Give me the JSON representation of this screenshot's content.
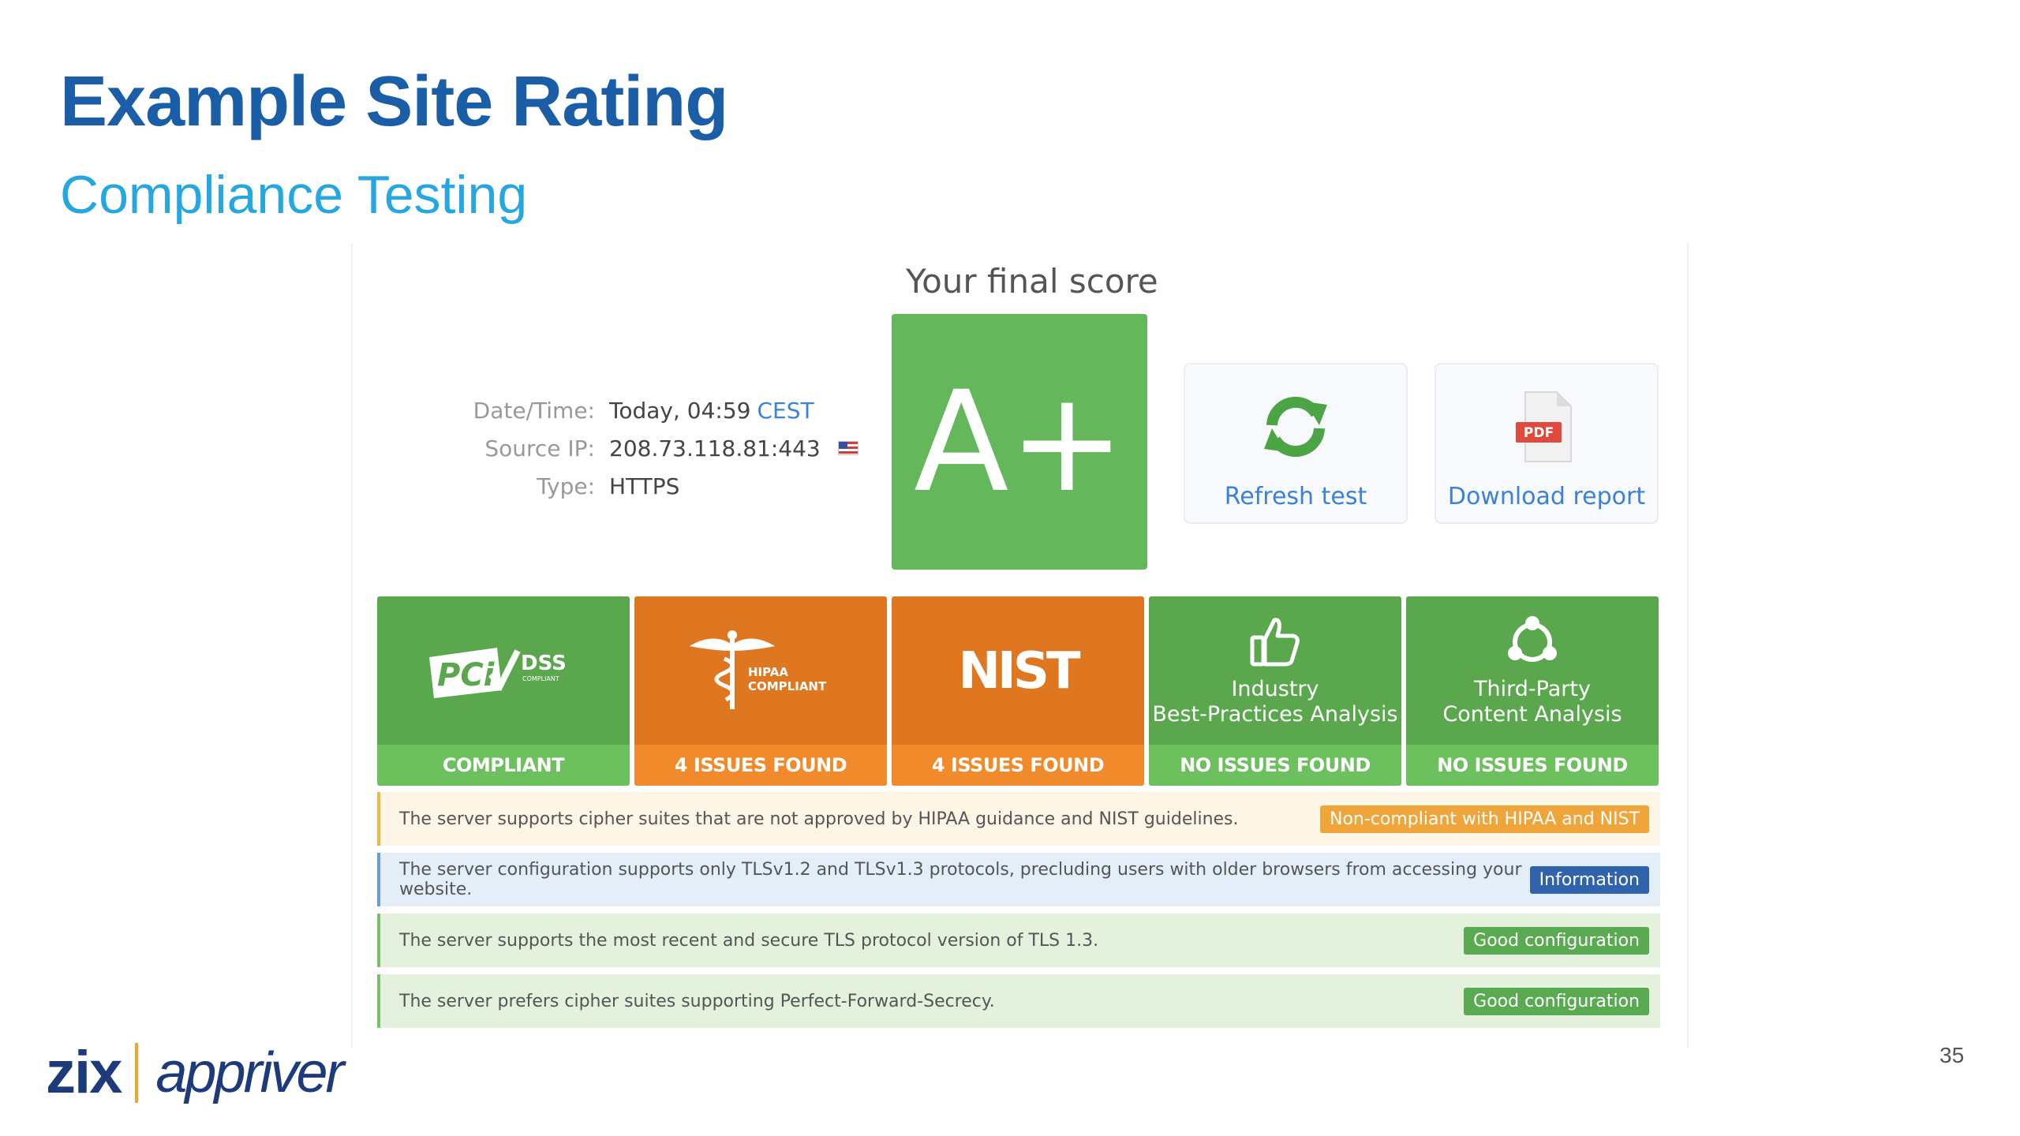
{
  "slide": {
    "title": "Example Site Rating",
    "subtitle": "Compliance Testing",
    "page_number": "35"
  },
  "score": {
    "heading": "Your final score",
    "grade": "A+",
    "grade_color": "#64b75a"
  },
  "info": {
    "rows": [
      {
        "key": "Date/Time:",
        "value": "Today, 04:59",
        "extra": "CEST"
      },
      {
        "key": "Source IP:",
        "value": "208.73.118.81:443",
        "flag": "us-flag-icon"
      },
      {
        "key": "Type:",
        "value": "HTTPS"
      }
    ]
  },
  "actions": {
    "refresh_label": "Refresh test",
    "download_label": "Download report",
    "pdf_text": "PDF"
  },
  "badges": [
    {
      "logo_main": "PCi",
      "logo_sub": "DSS",
      "logo_small": "COMPLIANT",
      "status": "COMPLIANT",
      "color": "green"
    },
    {
      "logo_main": "HIPAA",
      "logo_sub": "COMPLIANT",
      "status": "4 ISSUES FOUND",
      "color": "orange"
    },
    {
      "logo_main": "NIST",
      "status": "4 ISSUES FOUND",
      "color": "orange"
    },
    {
      "caption_line1": "Industry",
      "caption_line2": "Best-Practices Analysis",
      "status": "NO ISSUES FOUND",
      "color": "green"
    },
    {
      "caption_line1": "Third-Party",
      "caption_line2": "Content Analysis",
      "status": "NO ISSUES FOUND",
      "color": "green"
    }
  ],
  "alerts": [
    {
      "text": "The server supports cipher suites that are not approved by HIPAA guidance and NIST guidelines.",
      "tag": "Non-compliant with HIPAA and NIST",
      "kind": "warn"
    },
    {
      "text": "The server configuration supports only TLSv1.2 and TLSv1.3 protocols, precluding users with older browsers from accessing your website.",
      "tag": "Information",
      "kind": "info"
    },
    {
      "text": "The server supports the most recent and secure TLS protocol version of TLS 1.3.",
      "tag": "Good configuration",
      "kind": "good"
    },
    {
      "text": "The server prefers cipher suites supporting Perfect-Forward-Secrecy.",
      "tag": "Good configuration",
      "kind": "good"
    }
  ],
  "logo": {
    "brand1": "zix",
    "brand2": "appriver"
  }
}
